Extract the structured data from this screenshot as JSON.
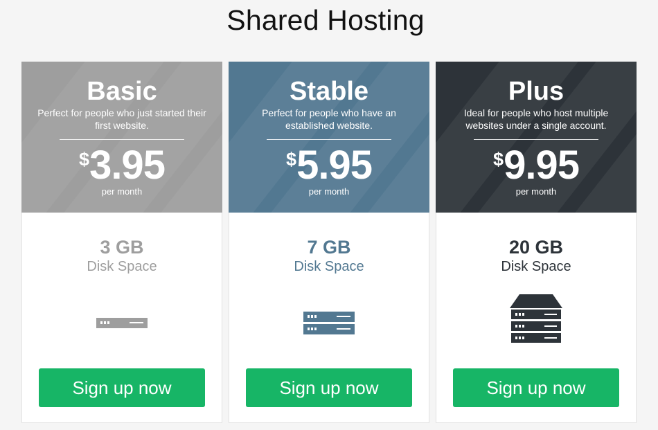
{
  "page": {
    "title": "Shared Hosting"
  },
  "plans": [
    {
      "name": "Basic",
      "description": "Perfect for people who just started their first website.",
      "currency": "$",
      "price": "3.95",
      "period": "per month",
      "disk_amount": "3 GB",
      "disk_label": "Disk Space",
      "server_units": 1,
      "button_label": "Sign up now",
      "colors": {
        "header": "#9e9e9e",
        "text": "#9e9e9e",
        "icon": "#9e9e9e"
      }
    },
    {
      "name": "Stable",
      "description": "Perfect for people who have an established website.",
      "currency": "$",
      "price": "5.95",
      "period": "per month",
      "disk_amount": "7 GB",
      "disk_label": "Disk Space",
      "server_units": 2,
      "button_label": "Sign up now",
      "colors": {
        "header": "#527891",
        "text": "#527891",
        "icon": "#527891"
      }
    },
    {
      "name": "Plus",
      "description": "Ideal for people who host multiple websites under a single account.",
      "currency": "$",
      "price": "9.95",
      "period": "per month",
      "disk_amount": "20 GB",
      "disk_label": "Disk Space",
      "server_units": 3,
      "button_label": "Sign up now",
      "colors": {
        "header": "#2d3339",
        "text": "#2d3339",
        "icon": "#2d3339"
      }
    }
  ],
  "accent_button": "#17b566"
}
